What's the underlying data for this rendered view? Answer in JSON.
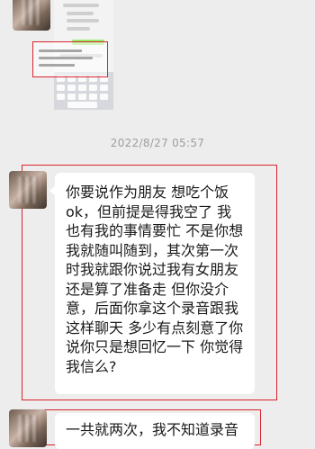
{
  "timestamp": "2022/8/27 05:57",
  "messages": [
    {
      "type": "text",
      "text": "你要说作为朋友 想吃个饭ok，但前提是得我空了 我也有我的事情要忙 不是你想我就随叫随到，其次第一次时我就跟你说过我有女朋友还是算了准备走 但你没介意，后面你拿这个录音跟我这样聊天 多少有点刻意了你说你只是想回忆一下 你觉得我信么?"
    },
    {
      "type": "text",
      "text": "一共就两次，我不知道录音"
    }
  ]
}
